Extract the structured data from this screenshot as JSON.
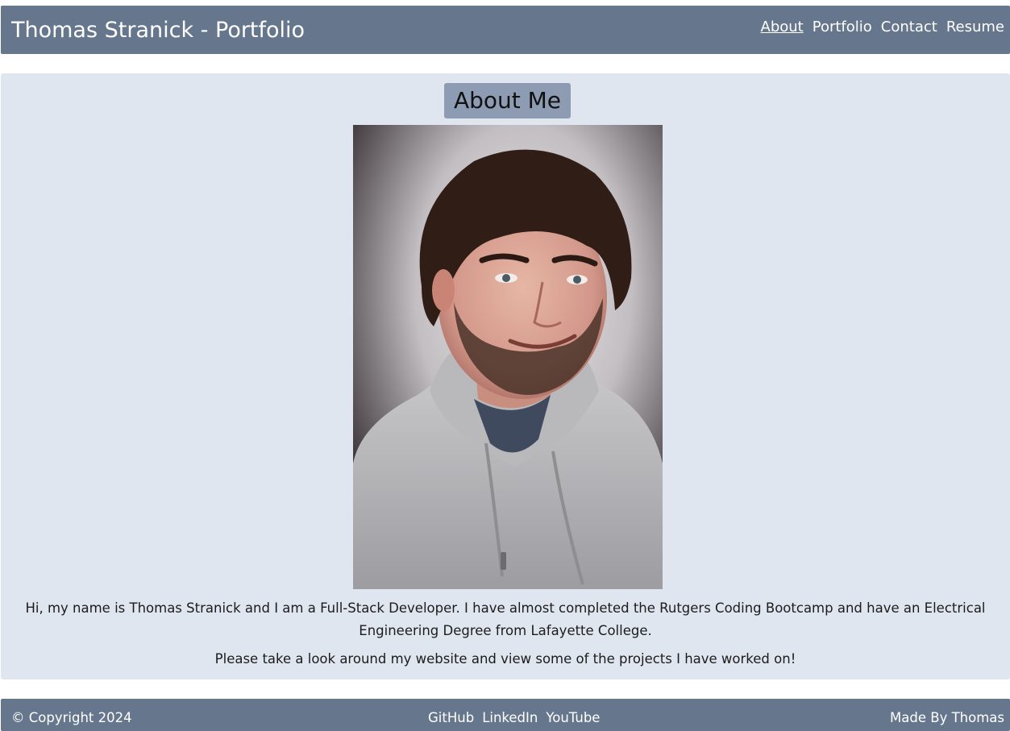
{
  "header": {
    "title": "Thomas Stranick - Portfolio",
    "nav": [
      {
        "label": "About",
        "active": true
      },
      {
        "label": "Portfolio",
        "active": false
      },
      {
        "label": "Contact",
        "active": false
      },
      {
        "label": "Resume",
        "active": false
      }
    ]
  },
  "about": {
    "heading": "About Me",
    "photo_alt": "Portrait photo of Thomas Stranick",
    "bio_1": "Hi, my name is Thomas Stranick and I am a Full-Stack Developer. I have almost completed the Rutgers Coding Bootcamp and have an Electrical Engineering Degree from Lafayette College.",
    "bio_2": "Please take a look around my website and view some of the projects I have worked on!"
  },
  "footer": {
    "copyright": "© Copyright 2024",
    "links": [
      "GitHub",
      "LinkedIn",
      "YouTube"
    ],
    "made_by": "Made By Thomas"
  },
  "colors": {
    "header_bg": "#66768c",
    "about_bg": "#e0e6ef",
    "heading_bg": "#8d9bb3"
  }
}
